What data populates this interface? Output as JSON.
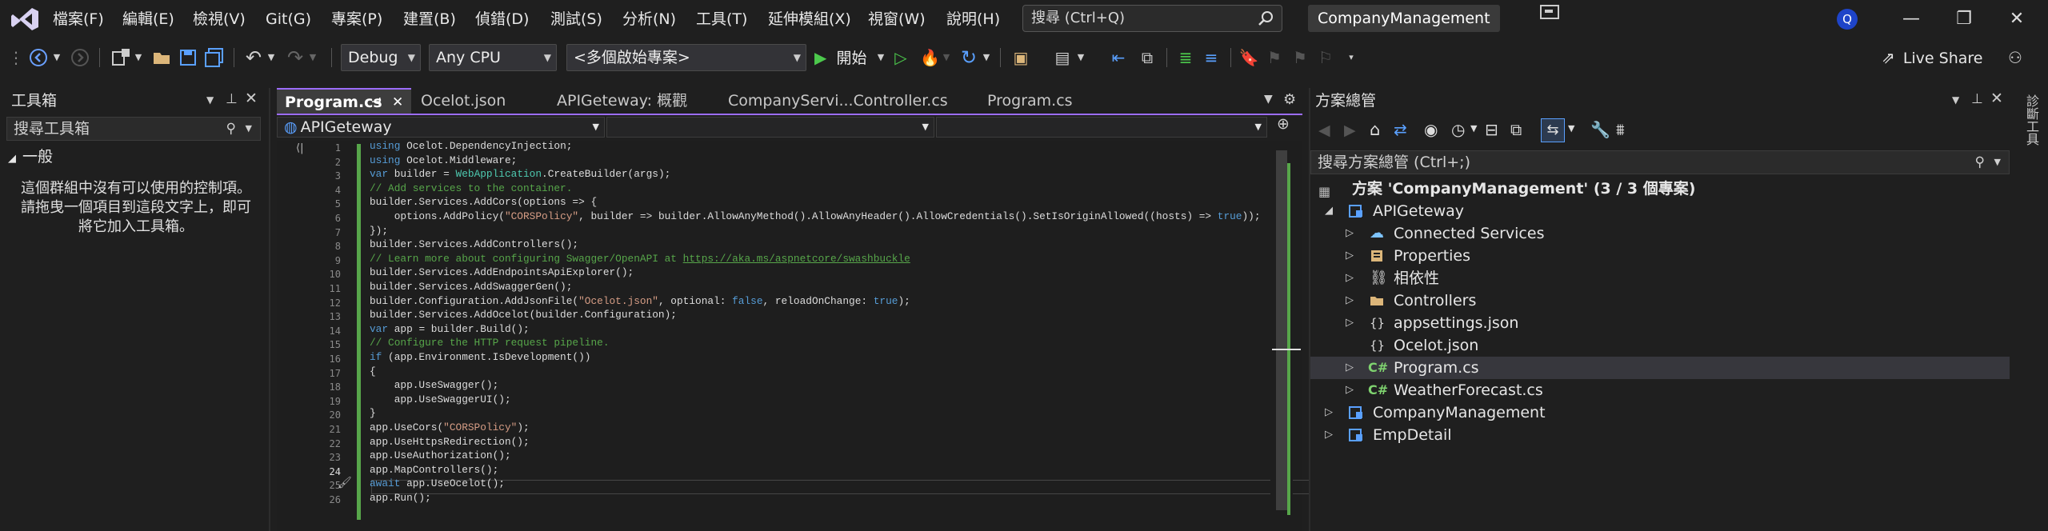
{
  "menu": [
    "檔案(F)",
    "編輯(E)",
    "檢視(V)",
    "Git(G)",
    "專案(P)",
    "建置(B)",
    "偵錯(D)",
    "測試(S)",
    "分析(N)",
    "工具(T)",
    "延伸模組(X)",
    "視窗(W)",
    "說明(H)"
  ],
  "search": {
    "placeholder": "搜尋 (Ctrl+Q)"
  },
  "solution_name": "CompanyManagement",
  "user_initial": "Q",
  "toolbar": {
    "config": "Debug",
    "platform": "Any CPU",
    "startup_projects": "<多個啟始專案>",
    "start_label": "開始",
    "live_share": "Live Share"
  },
  "toolbox": {
    "title": "工具箱",
    "search_placeholder": "搜尋工具箱",
    "group": "一般",
    "empty_message": "這個群組中沒有可以使用的控制項。請拖曳一個項目到這段文字上，即可將它加入工具箱。"
  },
  "tabs": [
    "Program.cs",
    "Ocelot.json",
    "APIGeteway: 概觀",
    "CompanyServi...Controller.cs",
    "Program.cs"
  ],
  "navbar": {
    "project": "APIGeteway"
  },
  "code": {
    "line_numbers": [
      "1",
      "2",
      "3",
      "4",
      "5",
      "6",
      "7",
      "8",
      "9",
      "10",
      "11",
      "12",
      "13",
      "14",
      "15",
      "16",
      "17",
      "18",
      "19",
      "20",
      "21",
      "22",
      "23",
      "24",
      "25",
      "26"
    ],
    "current_line": "24"
  },
  "solution_explorer": {
    "title": "方案總管",
    "search_placeholder": "搜尋方案總管 (Ctrl+;)",
    "solution_label": "方案 'CompanyManagement' (3 / 3 個專案)",
    "items": [
      {
        "label": "APIGeteway"
      },
      {
        "label": "Connected Services"
      },
      {
        "label": "Properties"
      },
      {
        "label": "相依性"
      },
      {
        "label": "Controllers"
      },
      {
        "label": "appsettings.json"
      },
      {
        "label": "Ocelot.json"
      },
      {
        "label": "Program.cs"
      },
      {
        "label": "WeatherForecast.cs"
      },
      {
        "label": "CompanyManagement"
      },
      {
        "label": "EmpDetail"
      }
    ]
  },
  "side_tab": "診斷工具",
  "colors": {
    "accent": "#9c6cff",
    "keyword": "#569cd6",
    "string": "#d69d85",
    "comment": "#57a64a",
    "type": "#4ec9b0"
  }
}
